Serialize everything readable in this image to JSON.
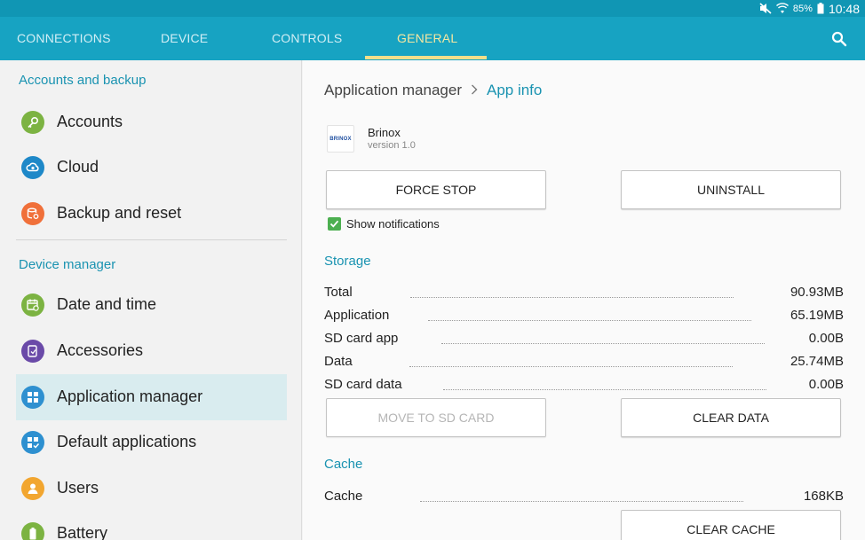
{
  "status_bar": {
    "battery": "85%",
    "time": "10:48",
    "icons": [
      "mute-icon",
      "wifi-icon",
      "battery-icon"
    ]
  },
  "tabs": [
    {
      "label": "CONNECTIONS",
      "active": false
    },
    {
      "label": "DEVICE",
      "active": false
    },
    {
      "label": "CONTROLS",
      "active": false
    },
    {
      "label": "GENERAL",
      "active": true
    }
  ],
  "sidebar": {
    "sections": [
      {
        "header": "Accounts and backup",
        "items": [
          {
            "label": "Accounts",
            "icon": "key-icon",
            "color": "#7cb342"
          },
          {
            "label": "Cloud",
            "icon": "cloud-icon",
            "color": "#1e88c8"
          },
          {
            "label": "Backup and reset",
            "icon": "backup-icon",
            "color": "#f0703a"
          }
        ]
      },
      {
        "header": "Device manager",
        "items": [
          {
            "label": "Date and time",
            "icon": "calendar-icon",
            "color": "#7cb342"
          },
          {
            "label": "Accessories",
            "icon": "accessories-icon",
            "color": "#6a4aa8"
          },
          {
            "label": "Application manager",
            "icon": "grid-icon",
            "color": "#2e90d0",
            "selected": true
          },
          {
            "label": "Default applications",
            "icon": "default-apps-icon",
            "color": "#2e90d0"
          },
          {
            "label": "Users",
            "icon": "user-icon",
            "color": "#f2a630"
          },
          {
            "label": "Battery",
            "icon": "battery-icon",
            "color": "#7cb342"
          }
        ]
      }
    ]
  },
  "main": {
    "breadcrumb": {
      "parent": "Application manager",
      "current": "App info"
    },
    "app": {
      "name": "Brinox",
      "version": "version 1.0",
      "logo_text": "BRINOX"
    },
    "buttons": {
      "force_stop": "FORCE STOP",
      "uninstall": "UNINSTALL",
      "move_to_sd": "MOVE TO SD CARD",
      "clear_data": "CLEAR DATA",
      "clear_cache": "CLEAR CACHE"
    },
    "notifications": {
      "label": "Show notifications",
      "checked": true
    },
    "storage": {
      "header": "Storage",
      "rows": [
        {
          "label": "Total",
          "value": "90.93MB"
        },
        {
          "label": "Application",
          "value": "65.19MB"
        },
        {
          "label": "SD card app",
          "value": "0.00B"
        },
        {
          "label": "Data",
          "value": "25.74MB"
        },
        {
          "label": "SD card data",
          "value": "0.00B"
        }
      ]
    },
    "cache": {
      "header": "Cache",
      "rows": [
        {
          "label": "Cache",
          "value": "168KB"
        }
      ]
    }
  },
  "colors": {
    "accent": "#17a3c2",
    "status_bar": "#1096b4",
    "section_text": "#1a93b1",
    "active_tab": "#f6e7a0"
  }
}
